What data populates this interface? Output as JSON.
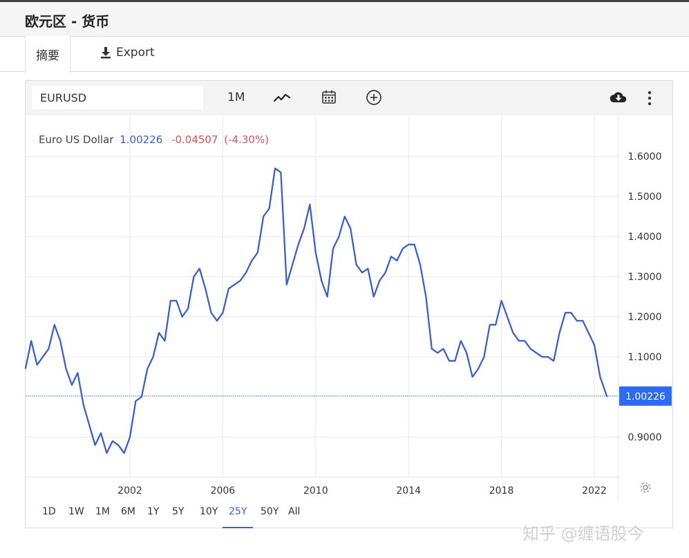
{
  "header": {
    "title": "欧元区 - 货币"
  },
  "tabs": {
    "summary_label": "摘要",
    "export_label": "Export"
  },
  "toolbar": {
    "symbol_value": "EURUSD",
    "interval_label": "1M",
    "icons": [
      "line-chart-icon",
      "calendar-icon",
      "plus-circle-icon",
      "cloud-download-icon",
      "more-vertical-icon"
    ]
  },
  "legend": {
    "name": "Euro US Dollar",
    "last": "1.00226",
    "change": "-0.04507",
    "change_pct": "(-4.30%)"
  },
  "price_tag": "1.00226",
  "ranges": [
    "1D",
    "1W",
    "1M",
    "6M",
    "1Y",
    "5Y",
    "10Y",
    "25Y",
    "50Y",
    "All"
  ],
  "active_range": "25Y",
  "colors": {
    "line": "#3a5fcd",
    "negative": "#d05454",
    "tag_bg": "#2f6bf0",
    "grid": "#e6e6e6"
  },
  "watermark": "知乎 @缠语股今",
  "chart_data": {
    "type": "line",
    "title": "",
    "xlabel": "",
    "ylabel": "",
    "xlim": [
      1997.5,
      2022.7
    ],
    "ylim": [
      0.83,
      1.75
    ],
    "x_ticks": [
      "2002",
      "2006",
      "2010",
      "2014",
      "2018",
      "2022"
    ],
    "y_ticks": [
      "1.6000",
      "1.5000",
      "1.4000",
      "1.3000",
      "1.2000",
      "1.1000",
      "0.9000"
    ],
    "reference_line": 1.00226,
    "grid": true,
    "series": [
      {
        "name": "Euro US Dollar",
        "x": [
          1997.5,
          1997.75,
          1998.0,
          1998.25,
          1998.5,
          1998.75,
          1999.0,
          1999.25,
          1999.5,
          1999.75,
          2000.0,
          2000.25,
          2000.5,
          2000.75,
          2001.0,
          2001.25,
          2001.5,
          2001.75,
          2002.0,
          2002.25,
          2002.5,
          2002.75,
          2003.0,
          2003.25,
          2003.5,
          2003.75,
          2004.0,
          2004.25,
          2004.5,
          2004.75,
          2005.0,
          2005.25,
          2005.5,
          2005.75,
          2006.0,
          2006.25,
          2006.5,
          2006.75,
          2007.0,
          2007.25,
          2007.5,
          2007.75,
          2008.0,
          2008.25,
          2008.5,
          2008.75,
          2009.0,
          2009.25,
          2009.5,
          2009.75,
          2010.0,
          2010.25,
          2010.5,
          2010.75,
          2011.0,
          2011.25,
          2011.5,
          2011.75,
          2012.0,
          2012.25,
          2012.5,
          2012.75,
          2013.0,
          2013.25,
          2013.5,
          2013.75,
          2014.0,
          2014.25,
          2014.5,
          2014.75,
          2015.0,
          2015.25,
          2015.5,
          2015.75,
          2016.0,
          2016.25,
          2016.5,
          2016.75,
          2017.0,
          2017.25,
          2017.5,
          2017.75,
          2018.0,
          2018.25,
          2018.5,
          2018.75,
          2019.0,
          2019.25,
          2019.5,
          2019.75,
          2020.0,
          2020.25,
          2020.5,
          2020.75,
          2021.0,
          2021.25,
          2021.5,
          2021.75,
          2022.0,
          2022.25,
          2022.55
        ],
        "values": [
          1.07,
          1.14,
          1.08,
          1.1,
          1.12,
          1.18,
          1.14,
          1.07,
          1.03,
          1.06,
          0.98,
          0.93,
          0.88,
          0.91,
          0.86,
          0.89,
          0.88,
          0.86,
          0.9,
          0.99,
          1.0,
          1.07,
          1.1,
          1.16,
          1.14,
          1.24,
          1.24,
          1.2,
          1.22,
          1.3,
          1.32,
          1.27,
          1.21,
          1.19,
          1.21,
          1.27,
          1.28,
          1.29,
          1.31,
          1.34,
          1.36,
          1.45,
          1.47,
          1.57,
          1.56,
          1.28,
          1.33,
          1.38,
          1.42,
          1.48,
          1.36,
          1.29,
          1.25,
          1.37,
          1.4,
          1.45,
          1.42,
          1.33,
          1.31,
          1.32,
          1.25,
          1.29,
          1.31,
          1.35,
          1.34,
          1.37,
          1.38,
          1.38,
          1.33,
          1.25,
          1.12,
          1.11,
          1.12,
          1.09,
          1.09,
          1.14,
          1.11,
          1.05,
          1.07,
          1.1,
          1.18,
          1.18,
          1.24,
          1.2,
          1.16,
          1.14,
          1.14,
          1.12,
          1.11,
          1.1,
          1.1,
          1.09,
          1.16,
          1.21,
          1.21,
          1.19,
          1.19,
          1.16,
          1.13,
          1.05,
          1.0
        ]
      }
    ]
  }
}
